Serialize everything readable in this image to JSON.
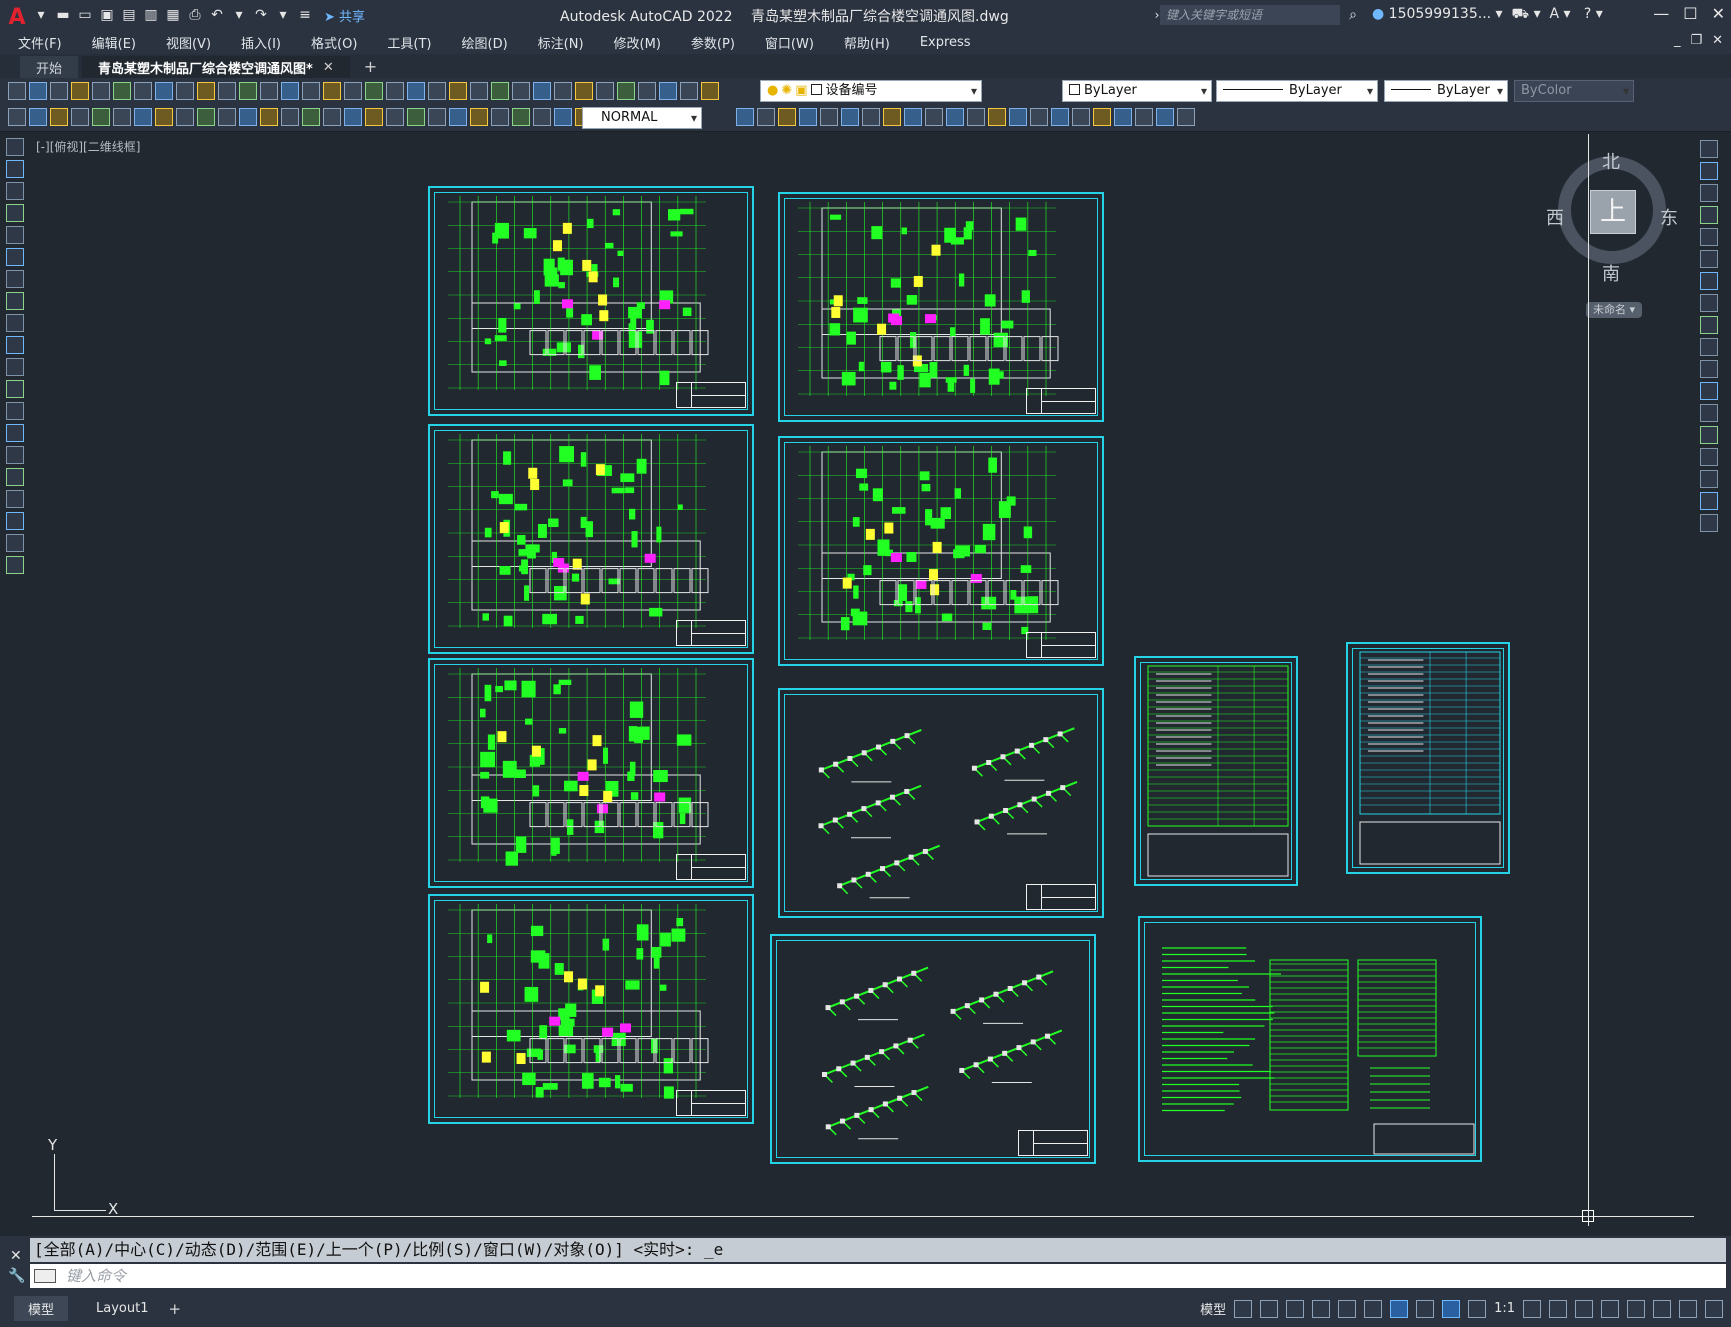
{
  "window": {
    "app_title": "Autodesk AutoCAD 2022",
    "file_title": "青岛某塑木制品厂综合楼空调通风图.dwg",
    "share_label": "共享",
    "search_placeholder": "键入关键字或短语",
    "user_name": "1505999135..."
  },
  "menu": [
    "文件(F)",
    "编辑(E)",
    "视图(V)",
    "插入(I)",
    "格式(O)",
    "工具(T)",
    "绘图(D)",
    "标注(N)",
    "修改(M)",
    "参数(P)",
    "窗口(W)",
    "帮助(H)",
    "Express"
  ],
  "tabs": [
    {
      "label": "开始"
    },
    {
      "label": "青岛某塑木制品厂综合楼空调通风图*",
      "active": true
    }
  ],
  "toolbar": {
    "layer_combo": "设备编号",
    "color_combo": "ByLayer",
    "linetype_combo": "ByLayer",
    "lineweight_combo": "ByLayer",
    "plotstyle_combo": "ByColor",
    "style_combo": "NORMAL"
  },
  "viewport": {
    "label": "[-][俯视][二维线框]",
    "viewcube": {
      "top": "上",
      "north": "北",
      "south": "南",
      "east": "东",
      "west": "西",
      "ucs": "未命名"
    },
    "ucs_x": "X",
    "ucs_y": "Y"
  },
  "command": {
    "history": "[全部(A)/中心(C)/动态(D)/范围(E)/上一个(P)/比例(S)/窗口(W)/对象(O)] <实时>: _e",
    "input_placeholder": "键入命令"
  },
  "status": {
    "layout_tabs": [
      {
        "label": "模型",
        "active": true
      },
      {
        "label": "Layout1"
      }
    ],
    "model_label": "模型",
    "scale": "1:1"
  },
  "colors": {
    "sheet_border": "#24d4e6",
    "drawing_green": "#22ff22",
    "drawing_yellow": "#ffff33",
    "drawing_magenta": "#ff22ff",
    "background": "#212830"
  }
}
